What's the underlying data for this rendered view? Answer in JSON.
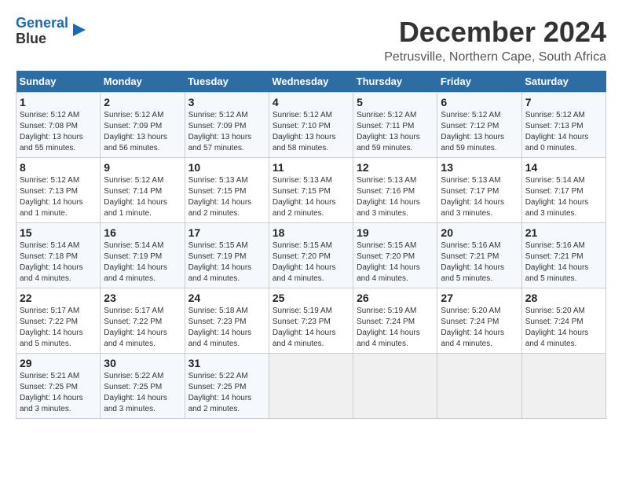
{
  "logo": {
    "line1": "General",
    "line2": "Blue"
  },
  "title": "December 2024",
  "location": "Petrusville, Northern Cape, South Africa",
  "days_of_week": [
    "Sunday",
    "Monday",
    "Tuesday",
    "Wednesday",
    "Thursday",
    "Friday",
    "Saturday"
  ],
  "weeks": [
    [
      {
        "day": 1,
        "info": "Sunrise: 5:12 AM\nSunset: 7:08 PM\nDaylight: 13 hours\nand 55 minutes."
      },
      {
        "day": 2,
        "info": "Sunrise: 5:12 AM\nSunset: 7:09 PM\nDaylight: 13 hours\nand 56 minutes."
      },
      {
        "day": 3,
        "info": "Sunrise: 5:12 AM\nSunset: 7:09 PM\nDaylight: 13 hours\nand 57 minutes."
      },
      {
        "day": 4,
        "info": "Sunrise: 5:12 AM\nSunset: 7:10 PM\nDaylight: 13 hours\nand 58 minutes."
      },
      {
        "day": 5,
        "info": "Sunrise: 5:12 AM\nSunset: 7:11 PM\nDaylight: 13 hours\nand 59 minutes."
      },
      {
        "day": 6,
        "info": "Sunrise: 5:12 AM\nSunset: 7:12 PM\nDaylight: 13 hours\nand 59 minutes."
      },
      {
        "day": 7,
        "info": "Sunrise: 5:12 AM\nSunset: 7:13 PM\nDaylight: 14 hours\nand 0 minutes."
      }
    ],
    [
      {
        "day": 8,
        "info": "Sunrise: 5:12 AM\nSunset: 7:13 PM\nDaylight: 14 hours\nand 1 minute."
      },
      {
        "day": 9,
        "info": "Sunrise: 5:12 AM\nSunset: 7:14 PM\nDaylight: 14 hours\nand 1 minute."
      },
      {
        "day": 10,
        "info": "Sunrise: 5:13 AM\nSunset: 7:15 PM\nDaylight: 14 hours\nand 2 minutes."
      },
      {
        "day": 11,
        "info": "Sunrise: 5:13 AM\nSunset: 7:15 PM\nDaylight: 14 hours\nand 2 minutes."
      },
      {
        "day": 12,
        "info": "Sunrise: 5:13 AM\nSunset: 7:16 PM\nDaylight: 14 hours\nand 3 minutes."
      },
      {
        "day": 13,
        "info": "Sunrise: 5:13 AM\nSunset: 7:17 PM\nDaylight: 14 hours\nand 3 minutes."
      },
      {
        "day": 14,
        "info": "Sunrise: 5:14 AM\nSunset: 7:17 PM\nDaylight: 14 hours\nand 3 minutes."
      }
    ],
    [
      {
        "day": 15,
        "info": "Sunrise: 5:14 AM\nSunset: 7:18 PM\nDaylight: 14 hours\nand 4 minutes."
      },
      {
        "day": 16,
        "info": "Sunrise: 5:14 AM\nSunset: 7:19 PM\nDaylight: 14 hours\nand 4 minutes."
      },
      {
        "day": 17,
        "info": "Sunrise: 5:15 AM\nSunset: 7:19 PM\nDaylight: 14 hours\nand 4 minutes."
      },
      {
        "day": 18,
        "info": "Sunrise: 5:15 AM\nSunset: 7:20 PM\nDaylight: 14 hours\nand 4 minutes."
      },
      {
        "day": 19,
        "info": "Sunrise: 5:15 AM\nSunset: 7:20 PM\nDaylight: 14 hours\nand 4 minutes."
      },
      {
        "day": 20,
        "info": "Sunrise: 5:16 AM\nSunset: 7:21 PM\nDaylight: 14 hours\nand 5 minutes."
      },
      {
        "day": 21,
        "info": "Sunrise: 5:16 AM\nSunset: 7:21 PM\nDaylight: 14 hours\nand 5 minutes."
      }
    ],
    [
      {
        "day": 22,
        "info": "Sunrise: 5:17 AM\nSunset: 7:22 PM\nDaylight: 14 hours\nand 5 minutes."
      },
      {
        "day": 23,
        "info": "Sunrise: 5:17 AM\nSunset: 7:22 PM\nDaylight: 14 hours\nand 4 minutes."
      },
      {
        "day": 24,
        "info": "Sunrise: 5:18 AM\nSunset: 7:23 PM\nDaylight: 14 hours\nand 4 minutes."
      },
      {
        "day": 25,
        "info": "Sunrise: 5:19 AM\nSunset: 7:23 PM\nDaylight: 14 hours\nand 4 minutes."
      },
      {
        "day": 26,
        "info": "Sunrise: 5:19 AM\nSunset: 7:24 PM\nDaylight: 14 hours\nand 4 minutes."
      },
      {
        "day": 27,
        "info": "Sunrise: 5:20 AM\nSunset: 7:24 PM\nDaylight: 14 hours\nand 4 minutes."
      },
      {
        "day": 28,
        "info": "Sunrise: 5:20 AM\nSunset: 7:24 PM\nDaylight: 14 hours\nand 4 minutes."
      }
    ],
    [
      {
        "day": 29,
        "info": "Sunrise: 5:21 AM\nSunset: 7:25 PM\nDaylight: 14 hours\nand 3 minutes."
      },
      {
        "day": 30,
        "info": "Sunrise: 5:22 AM\nSunset: 7:25 PM\nDaylight: 14 hours\nand 3 minutes."
      },
      {
        "day": 31,
        "info": "Sunrise: 5:22 AM\nSunset: 7:25 PM\nDaylight: 14 hours\nand 2 minutes."
      },
      null,
      null,
      null,
      null
    ]
  ]
}
